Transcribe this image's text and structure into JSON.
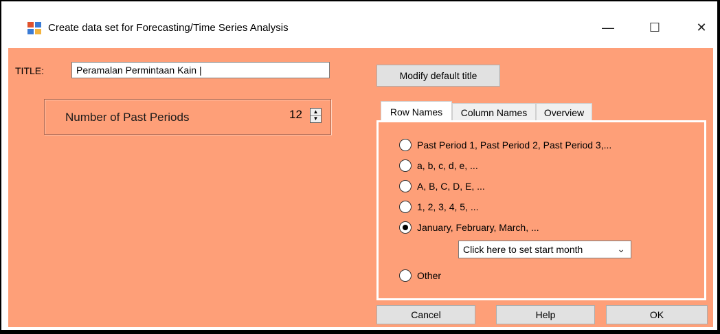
{
  "window": {
    "title": "Create data set for Forecasting/Time Series Analysis",
    "minimize_glyph": "—",
    "maximize_glyph": "☐",
    "close_glyph": "✕"
  },
  "form": {
    "title_label": "TITLE:",
    "title_value": "Peramalan Permintaan Kain |",
    "periods_label": "Number of Past Periods",
    "periods_value": "12",
    "modify_button": "Modify default title"
  },
  "tabs": [
    {
      "label": "Row Names",
      "active": true
    },
    {
      "label": "Column Names",
      "active": false
    },
    {
      "label": "Overview",
      "active": false
    }
  ],
  "row_names": {
    "options": [
      "Past Period 1, Past Period 2, Past Period 3,...",
      "a, b, c, d, e, ...",
      "A, B, C, D, E, ...",
      "1, 2, 3, 4, 5, ...",
      "January, February, March, ...",
      "Other"
    ],
    "selected_index": 4,
    "start_month_placeholder": "Click here to set start month"
  },
  "buttons": {
    "cancel": "Cancel",
    "help": "Help",
    "ok": "OK"
  },
  "colors": {
    "client_background": "#fe9f78"
  }
}
